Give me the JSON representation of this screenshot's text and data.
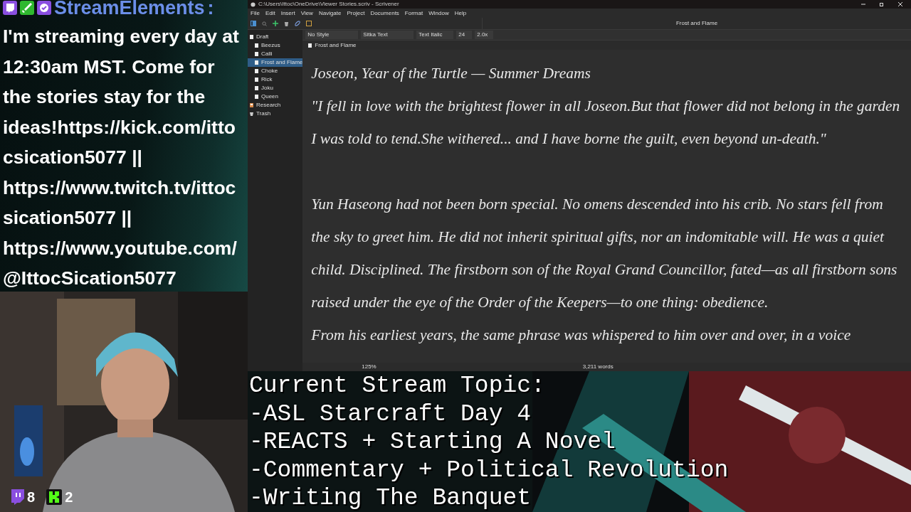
{
  "chat": {
    "username": "StreamElements",
    "separator": ":",
    "message": "I'm streaming every day at 12:30am MST. Come for the stories stay for the ideas!https://kick.com/ittocsication5077 || https://www.twitch.tv/ittocsication5077 || https://www.youtube.com/@IttocSication5077"
  },
  "webcam": {
    "viewer_counts": [
      {
        "kind": "twitch",
        "count": "8"
      },
      {
        "kind": "kick",
        "count": "2"
      }
    ]
  },
  "app": {
    "window": {
      "title": "C:\\Users\\Ittoc\\OneDrive\\Viewer Stories.scriv - Scrivener"
    },
    "menu": [
      "File",
      "Edit",
      "Insert",
      "View",
      "Navigate",
      "Project",
      "Documents",
      "Format",
      "Window",
      "Help"
    ],
    "header_title": "Frost and Flame",
    "binder": [
      {
        "label": "Draft",
        "kind": "folder",
        "selected": false,
        "children": [
          {
            "label": "Beezus",
            "kind": "doc",
            "selected": false
          },
          {
            "label": "Calli",
            "kind": "doc",
            "selected": false
          },
          {
            "label": "Frost and Flame",
            "kind": "doc",
            "selected": true
          },
          {
            "label": "Choke",
            "kind": "doc",
            "selected": false
          },
          {
            "label": "Rick",
            "kind": "doc",
            "selected": false
          },
          {
            "label": "Joku",
            "kind": "doc",
            "selected": false
          },
          {
            "label": "Queen",
            "kind": "doc",
            "selected": false
          }
        ]
      },
      {
        "label": "Research",
        "kind": "research",
        "selected": false
      },
      {
        "label": "Trash",
        "kind": "trash",
        "selected": false
      }
    ],
    "format_bar": {
      "style": "No Style",
      "font": "Sitka Text",
      "typeface": "Text Italic",
      "size": "24",
      "line_spacing": "2.0x"
    },
    "breadcrumb": "Frost and Flame",
    "paragraphs": [
      "Joseon, Year of the Turtle — Summer Dreams",
      "\"I fell in love with the brightest flower in all Joseon.But that flower did not belong in the garden I was told to tend.She withered... and I have borne the guilt, even beyond un-death.\"",
      "Yun Haseong had not been born special. No omens descended into his crib. No stars fell from the sky to greet him. He did not inherit spiritual gifts, nor an indomitable will. He was a quiet child. Disciplined. The firstborn son of the Royal Grand Councillor, fated—as all firstborn sons raised under the eye of the Order of the Keepers—to one thing: obedience.",
      "From his earliest years, the same phrase was whispered to him over and over, in a voice"
    ],
    "status": {
      "zoom": "125%",
      "word_count": "3,211 words"
    }
  },
  "topic_overlay": {
    "lines": [
      "Current Stream Topic:",
      "-ASL Starcraft Day 4",
      "-REACTS + Starting A Novel",
      "-Commentary + Political Revolution",
      "-Writing The Banquet"
    ]
  }
}
